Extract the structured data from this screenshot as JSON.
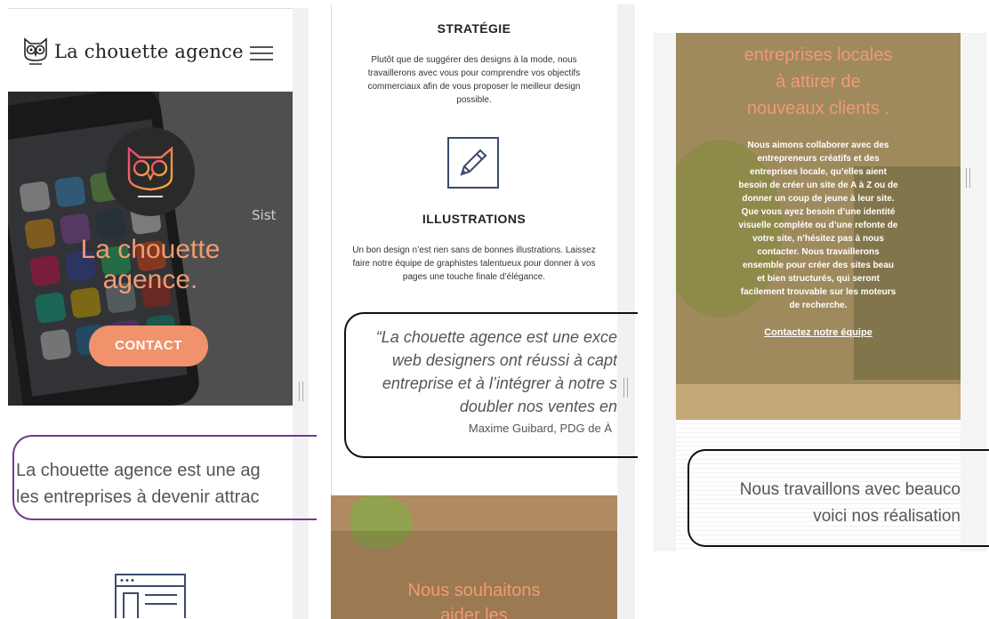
{
  "panel1": {
    "brand": "La chouette agence",
    "hero_title": "La chouette\nagence.",
    "hero_title_l1": "La chouette",
    "hero_title_l2": "agence.",
    "sketch_text": "Sist",
    "contact_button": "CONTACT",
    "quote_l1": "La chouette agence est une ag",
    "quote_l2": "les entreprises à devenir attrac"
  },
  "panel2": {
    "strategy_title": "STRATÉGIE",
    "strategy_body": "Plutôt que de suggérer des designs à la mode, nous travaillerons avec vous pour comprendre vos objectifs commerciaux afin de vous proposer le meilleur design possible.",
    "illustrations_title": "ILLUSTRATIONS",
    "illustrations_body": "Un bon design n’est rien sans de bonnes illustrations. Laissez faire notre équipe de graphistes talentueux pour donner à vos pages une touche finale d’élégance.",
    "quote_l1": "“La chouette agence est une exce",
    "quote_l2": "web designers ont réussi à capt",
    "quote_l3": "entreprise et à l’intégrer à notre s",
    "quote_l4": "doubler nos ventes en",
    "quote_author": "Maxime Guibard, PDG de À",
    "section_title_l1": "Nous souhaitons",
    "section_title_l2": "aider les"
  },
  "panel3": {
    "title_l1": "entreprises locales",
    "title_l2": "à attirer de",
    "title_l3": "nouveaux clients .",
    "body": "Nous aimons collaborer avec des entrepreneurs créatifs et des entreprises locale, qu’elles aient besoin de créer un site de A à Z ou de donner un coup de jeune à leur site. Que vous ayez besoin d’une identité visuelle complète ou d’une refonte de votre site, n’hésitez pas à nous contacter. Nous travaillerons ensemble pour créer des sites beau et bien structurés, qui seront facilement trouvable sur les moteurs de recherche.",
    "link": "Contactez notre équipe",
    "quote_l1": "Nous travaillons avec beauco",
    "quote_l2": "voici nos réalisation"
  },
  "colors": {
    "accent": "#f0926b",
    "quote_border_1": "#6b3d8e",
    "icon_blue": "#3c4a6e"
  },
  "icons": [
    "owl-logo-icon",
    "hamburger-menu-icon",
    "owl-hero-icon",
    "pencil-icon",
    "browser-window-icon"
  ]
}
